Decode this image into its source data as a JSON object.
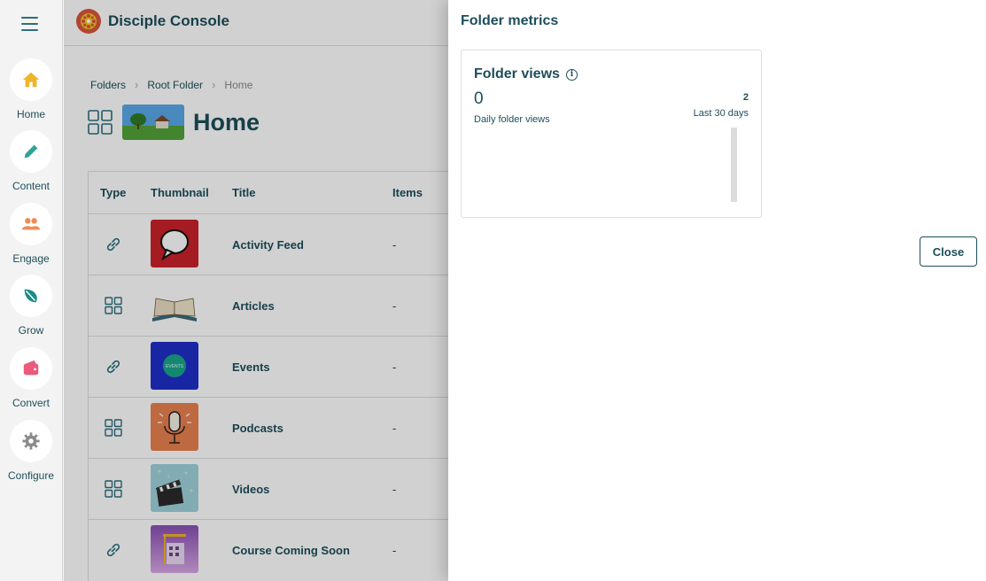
{
  "nav": {
    "items": [
      {
        "label": "Home",
        "icon": "home-icon",
        "color": "#f0b429"
      },
      {
        "label": "Content",
        "icon": "pencil-icon",
        "color": "#2fa39a"
      },
      {
        "label": "Engage",
        "icon": "people-icon",
        "color": "#f28b50"
      },
      {
        "label": "Grow",
        "icon": "leaf-icon",
        "color": "#1c8a87"
      },
      {
        "label": "Convert",
        "icon": "wallet-icon",
        "color": "#ea5a7b"
      },
      {
        "label": "Configure",
        "icon": "gear-icon",
        "color": "#8a8a8a"
      }
    ]
  },
  "brand": {
    "title": "Disciple Console"
  },
  "breadcrumb": {
    "items": [
      "Folders",
      "Root Folder"
    ],
    "current": "Home"
  },
  "page": {
    "title": "Home"
  },
  "table": {
    "headers": [
      "Type",
      "Thumbnail",
      "Title",
      "Items"
    ],
    "rows": [
      {
        "type": "link",
        "title": "Activity Feed",
        "items": "-"
      },
      {
        "type": "folder",
        "title": "Articles",
        "items": "-"
      },
      {
        "type": "link",
        "title": "Events",
        "items": "-"
      },
      {
        "type": "folder",
        "title": "Podcasts",
        "items": "-"
      },
      {
        "type": "folder",
        "title": "Videos",
        "items": "-"
      },
      {
        "type": "link",
        "title": "Course Coming Soon",
        "items": "-"
      }
    ]
  },
  "drawer": {
    "title": "Folder metrics",
    "card": {
      "title": "Folder views",
      "value": "0",
      "value_label": "Daily folder views",
      "total": "2",
      "total_label": "Last 30 days"
    },
    "close_label": "Close"
  },
  "thumb_text": {
    "events": "EVENTS"
  }
}
